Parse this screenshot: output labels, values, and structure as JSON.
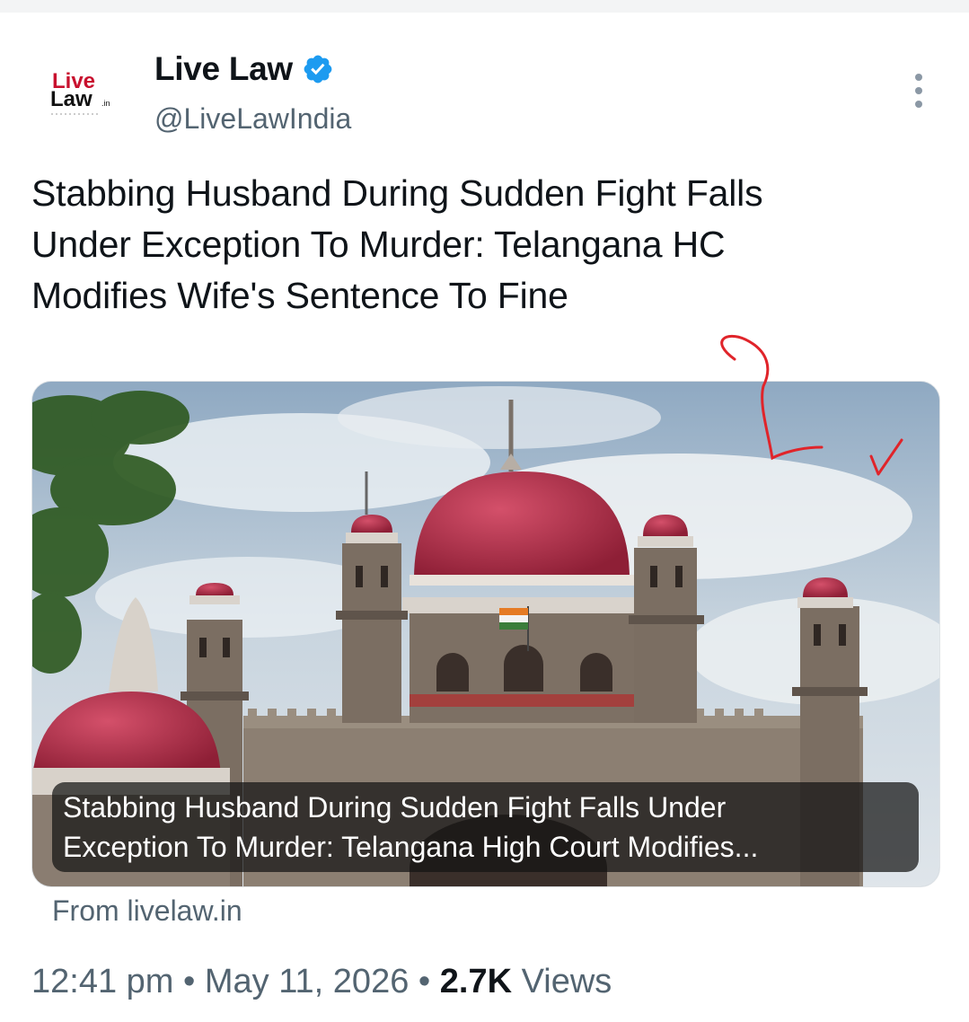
{
  "account": {
    "display_name": "Live Law",
    "handle": "@LiveLawIndia",
    "verified": true,
    "avatar_logo_text": [
      "Live",
      "Law",
      ".in"
    ]
  },
  "tweet": {
    "headline_lines": [
      "Stabbing Husband During Sudden Fight Falls",
      "Under Exception To Murder: Telangana HC",
      "Modifies Wife's Sentence To Fine"
    ]
  },
  "link_card": {
    "caption_lines": [
      "Stabbing Husband During Sudden Fight Falls Under",
      "Exception To Murder: Telangana High Court Modifies..."
    ],
    "source": "From livelaw.in"
  },
  "meta": {
    "time": "12:41 pm",
    "separator": "•",
    "date": "May 11, 2026",
    "views_count": "2.7K",
    "views_label": "Views"
  },
  "icons": [
    "verified-badge-icon",
    "more-options-icon"
  ],
  "colors": {
    "brand_red": "#c8102e",
    "verified_blue": "#1d9bf0",
    "secondary_text": "#536471",
    "annotation_red": "#e0242a"
  }
}
